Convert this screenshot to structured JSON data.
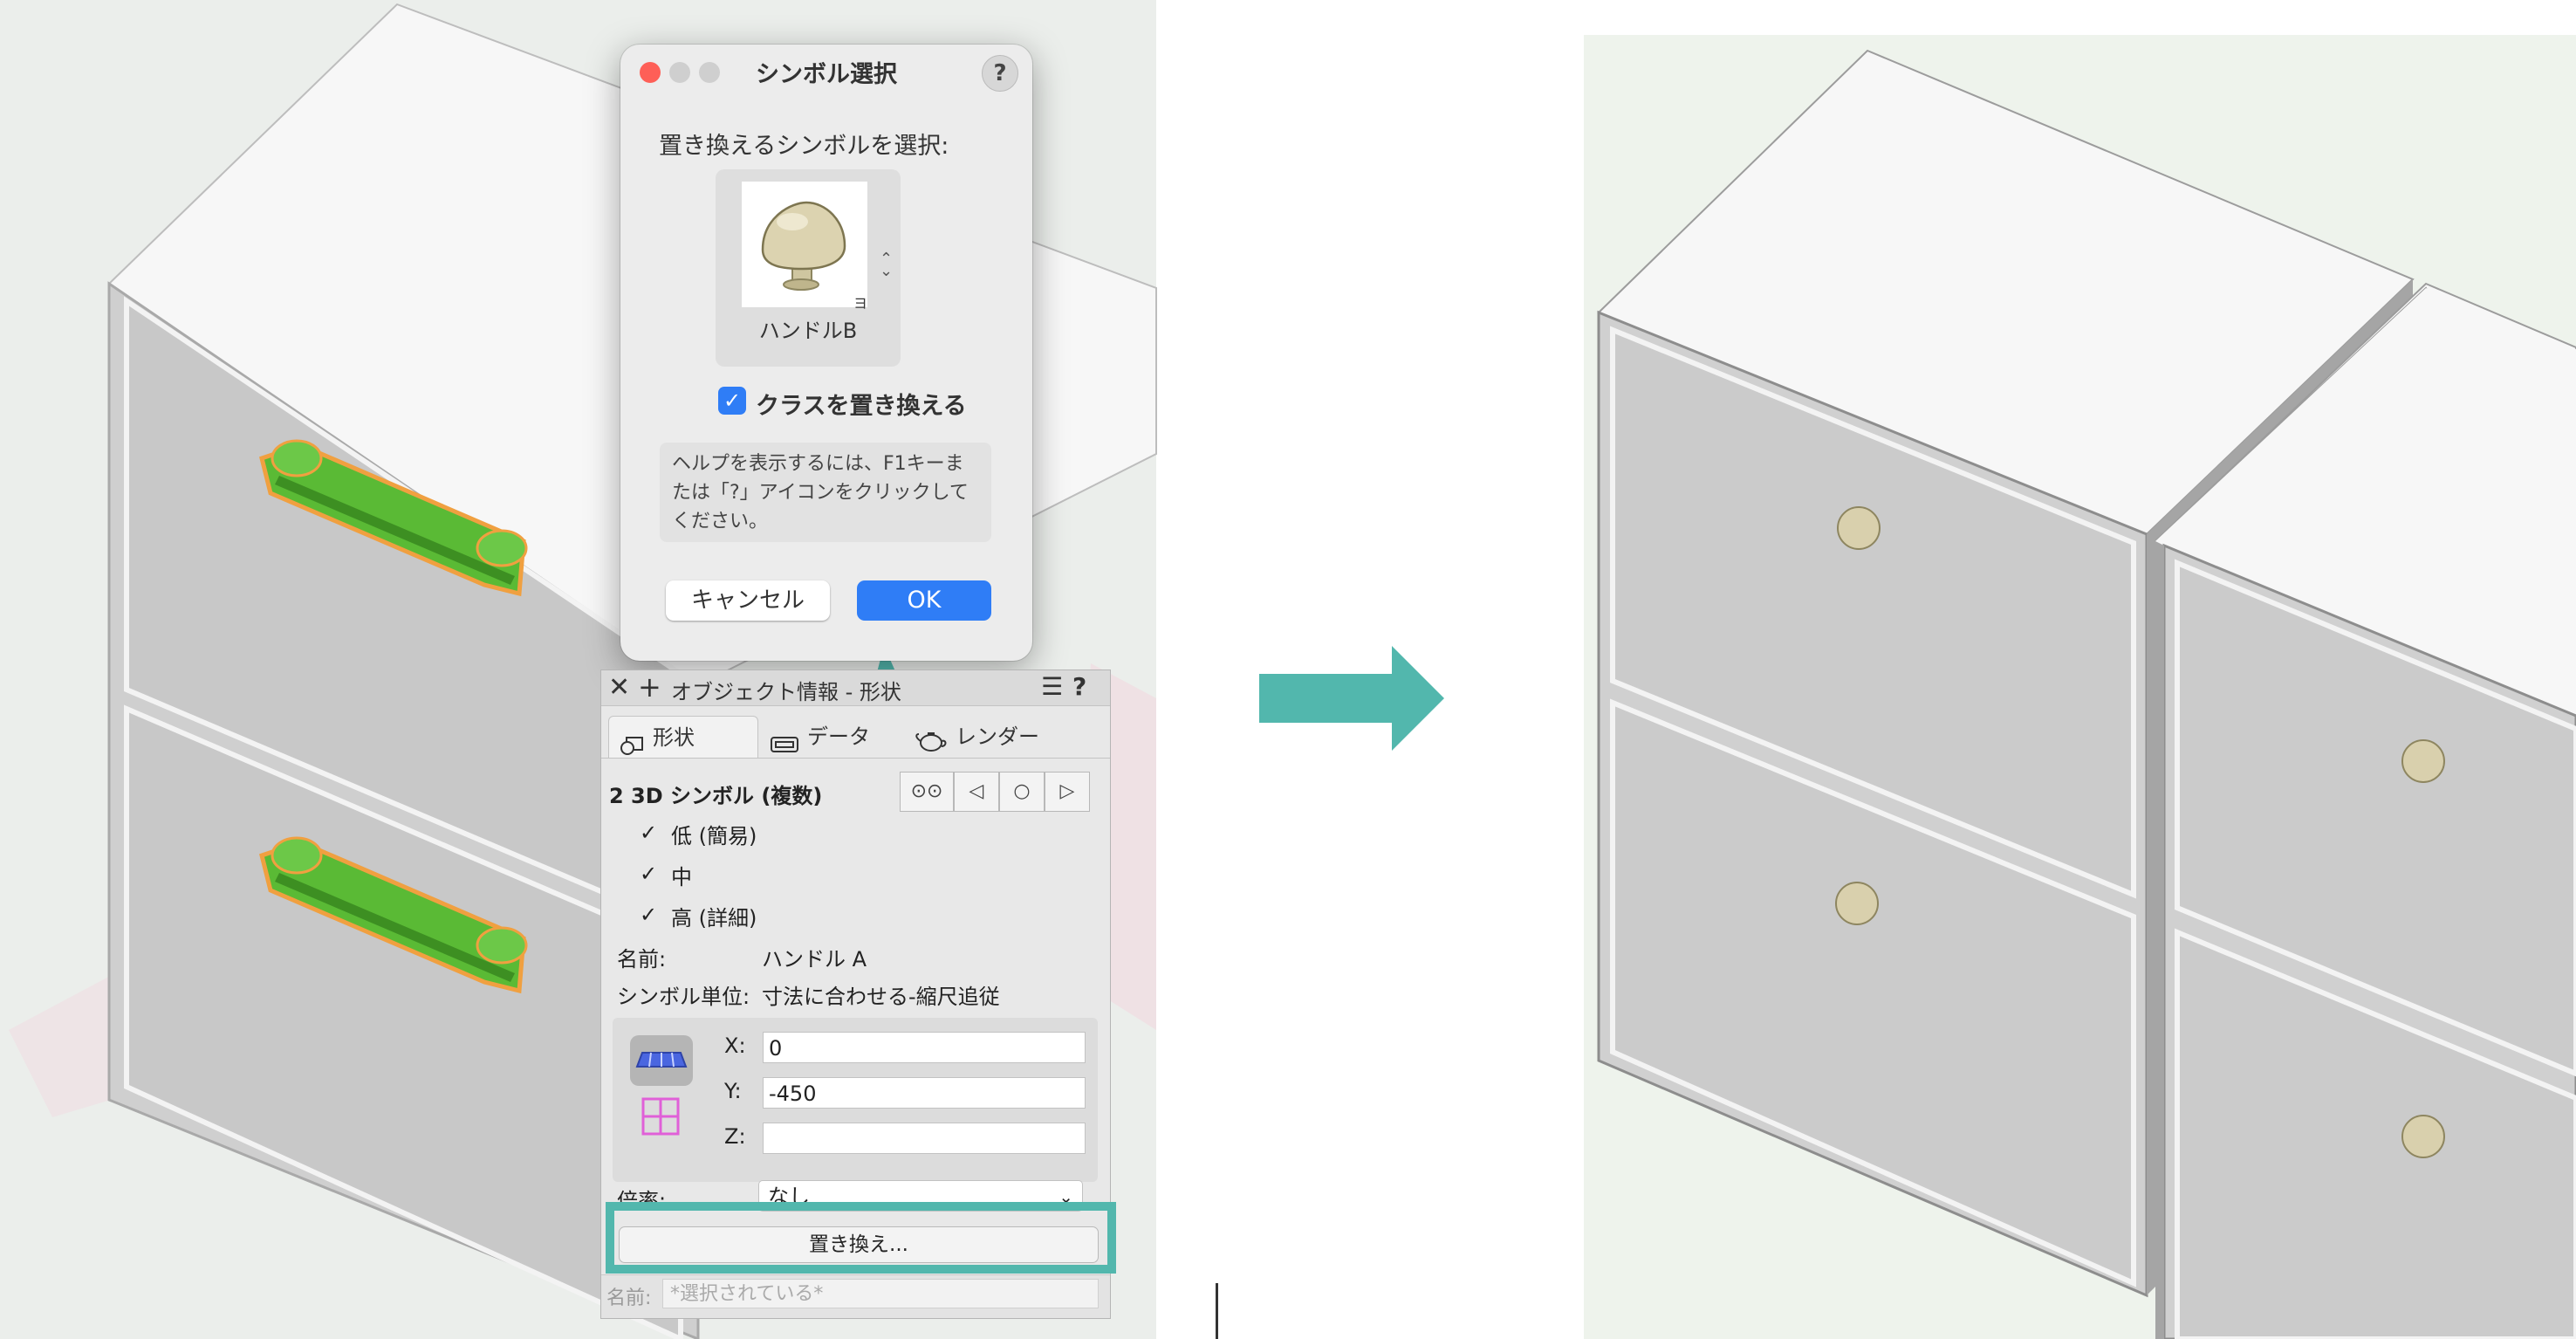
{
  "colors": {
    "accent_teal": "#52b7ad",
    "ok_blue": "#2f7df6",
    "selection_green": "#4caf2c",
    "selection_orange": "#f0a040",
    "knob": "#d9d0ad"
  },
  "dialog": {
    "title": "シンボル選択",
    "help_button": "?",
    "select_label": "置き換えるシンボルを選択:",
    "symbol_name": "ハンドルB",
    "replace_class_checkbox": {
      "label": "クラスを置き換える",
      "checked": true
    },
    "help_text": "ヘルプを表示するには、F1キーまたは「?」アイコンをクリックしてください。",
    "cancel_label": "キャンセル",
    "ok_label": "OK",
    "icons": [
      "close-dot-icon",
      "minimize-dot-icon",
      "zoom-dot-icon",
      "stepper-icon"
    ]
  },
  "oip": {
    "title": "オブジェクト情報 - 形状",
    "close_glyph": "✕",
    "add_glyph": "+",
    "menu_glyph": "☰",
    "help_glyph": "?",
    "tabs": [
      {
        "label": "形状",
        "icon": "shape-icon",
        "active": true
      },
      {
        "label": "データ",
        "icon": "data-icon",
        "active": false
      },
      {
        "label": "レンダー",
        "icon": "render-teapot-icon",
        "active": false
      }
    ],
    "selection_summary": "2 3D シンボル (複数)",
    "nav_buttons": [
      "⊙⊙",
      "◁",
      "○",
      "▷"
    ],
    "detail_levels": [
      {
        "label": "低 (簡易)",
        "checked": true
      },
      {
        "label": "中",
        "checked": true
      },
      {
        "label": "高 (詳細)",
        "checked": true
      }
    ],
    "name_label": "名前:",
    "name_value": "ハンドル A",
    "symbol_unit_label": "シンボル単位:",
    "symbol_unit_value": "寸法に合わせる-縮尺追従",
    "x_label": "X:",
    "x_value": "0",
    "y_label": "Y:",
    "y_value": "-450",
    "z_label": "Z:",
    "z_value": "",
    "scale_label": "倍率:",
    "scale_value": "なし",
    "replace_button": "置き換え...",
    "bottom_name_label": "名前:",
    "bottom_name_placeholder": "*選択されている*"
  }
}
